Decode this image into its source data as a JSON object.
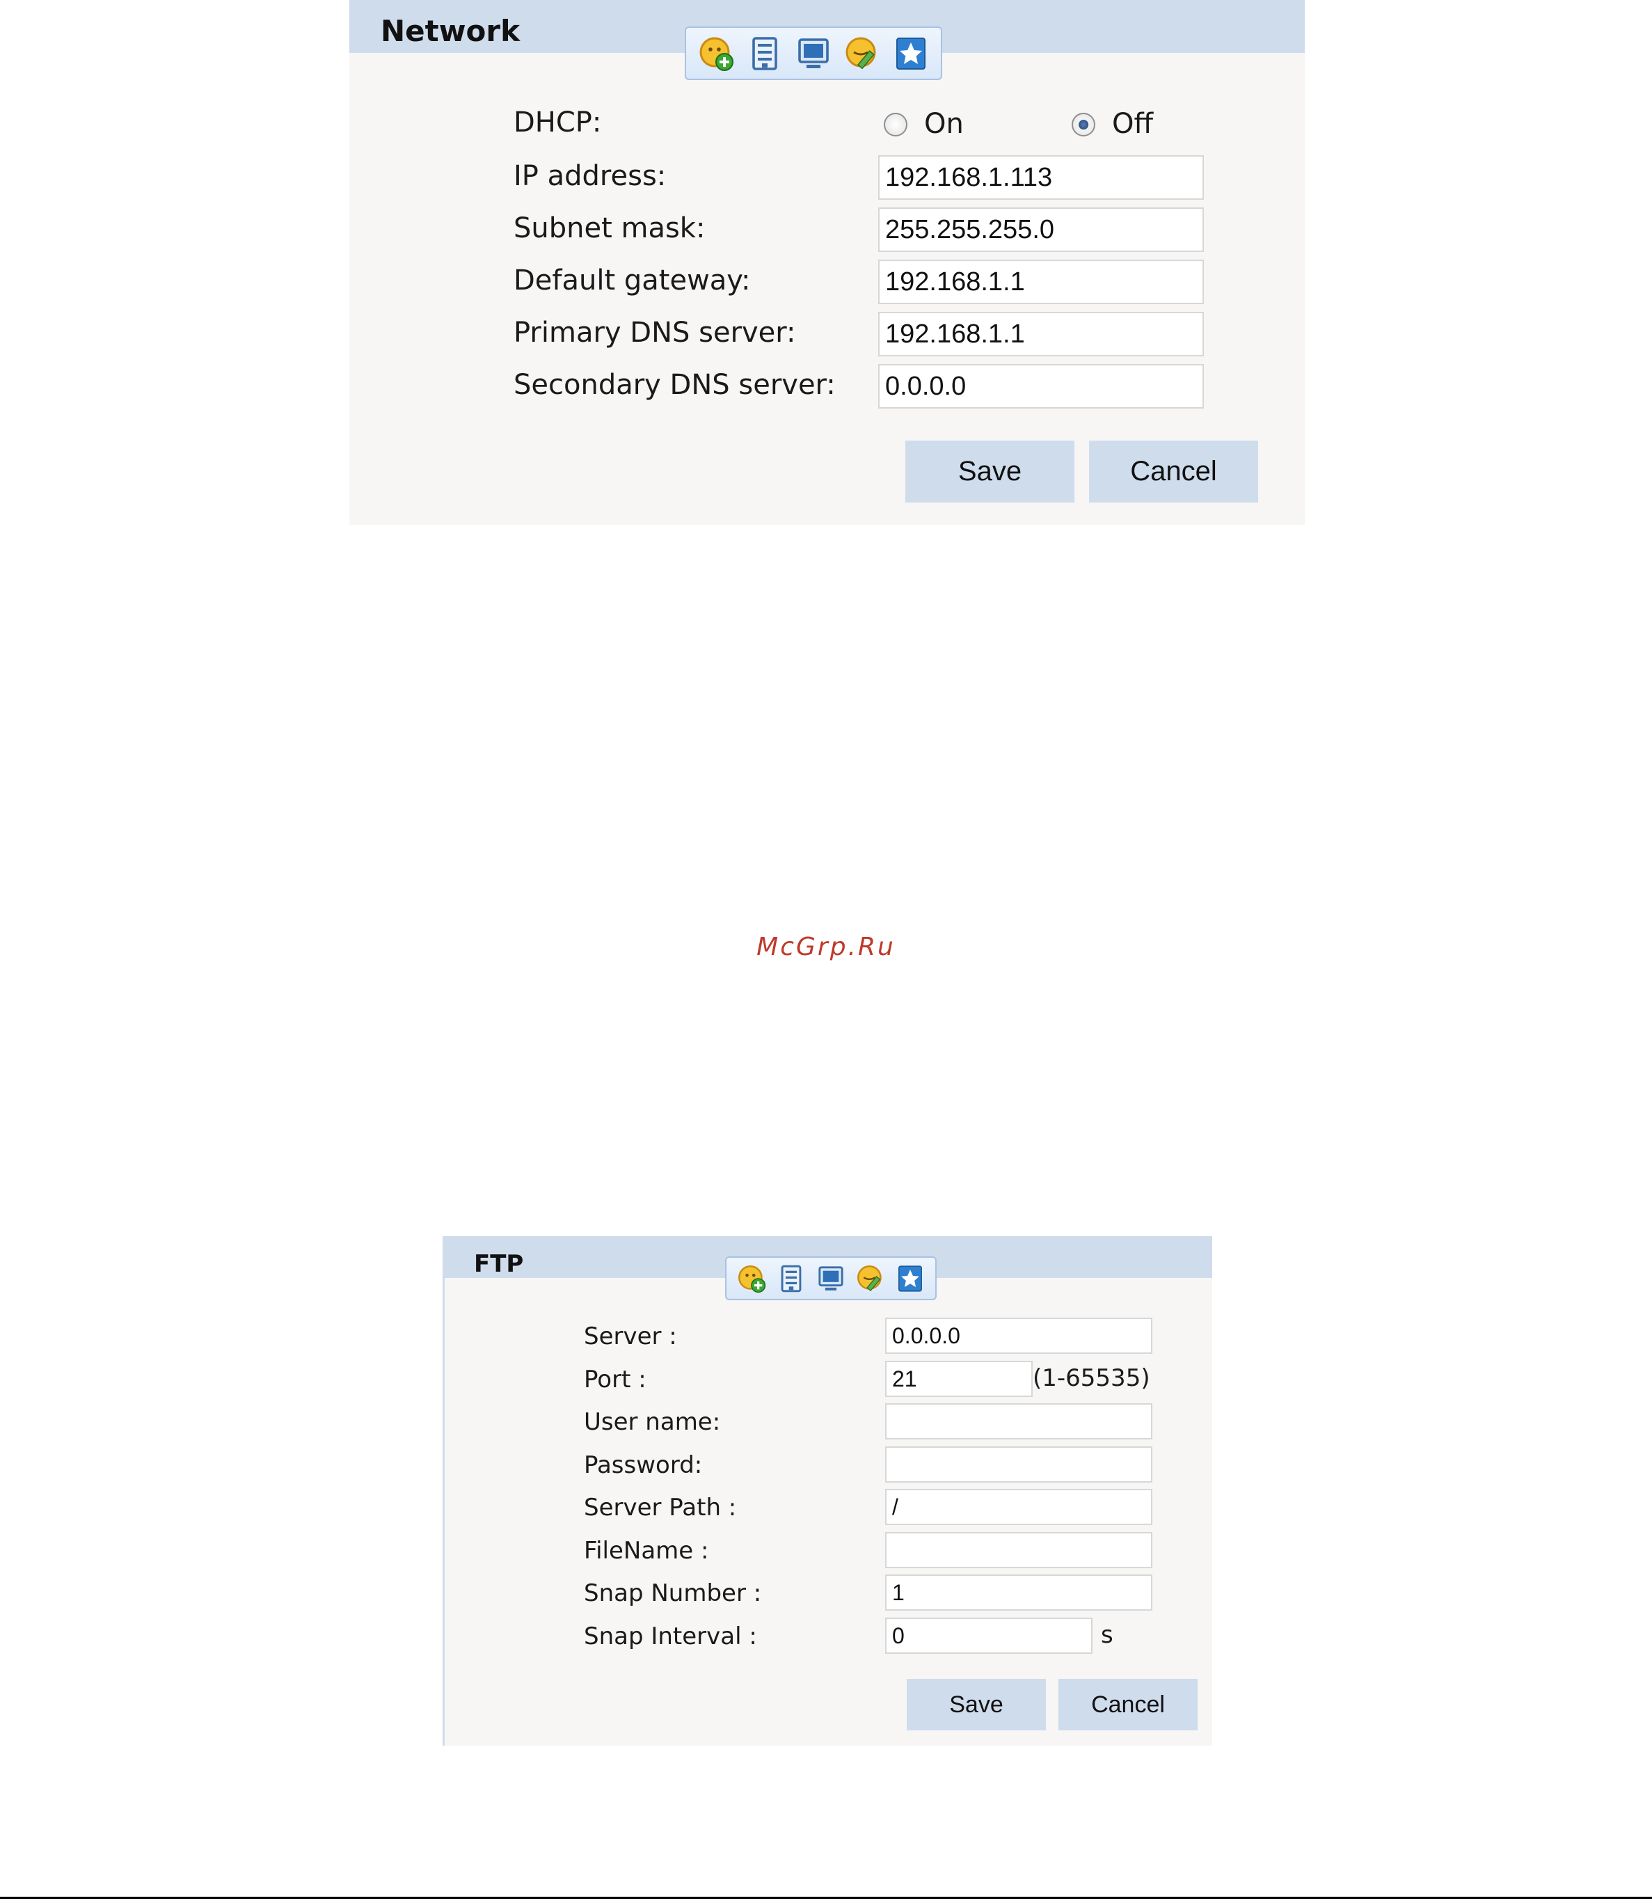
{
  "network": {
    "title": "Network",
    "toolbar_icons": [
      "add-icon",
      "save-icon",
      "monitor-icon",
      "edit-icon",
      "favorite-icon"
    ],
    "dhcp": {
      "label": "DHCP:",
      "on_label": "On",
      "off_label": "Off",
      "selected": "Off"
    },
    "fields": [
      {
        "label": "IP address:",
        "value": "192.168.1.113"
      },
      {
        "label": "Subnet mask:",
        "value": "255.255.255.0"
      },
      {
        "label": "Default gateway:",
        "value": "192.168.1.1"
      },
      {
        "label": "Primary DNS server:",
        "value": "192.168.1.1"
      },
      {
        "label": "Secondary DNS server:",
        "value": "0.0.0.0"
      }
    ],
    "save_label": "Save",
    "cancel_label": "Cancel"
  },
  "watermark": "McGrp.Ru",
  "ftp": {
    "title": "FTP",
    "toolbar_icons": [
      "add-icon",
      "save-icon",
      "monitor-icon",
      "edit-icon",
      "favorite-icon"
    ],
    "fields": [
      {
        "label": "Server :",
        "value": "0.0.0.0"
      },
      {
        "label": "Port :",
        "value": "21",
        "suffix": "(1-65535)"
      },
      {
        "label": "User name:",
        "value": ""
      },
      {
        "label": "Password:",
        "value": ""
      },
      {
        "label": "Server Path :",
        "value": "/"
      },
      {
        "label": "FileName :",
        "value": ""
      },
      {
        "label": "Snap Number :",
        "value": "1"
      },
      {
        "label": "Snap Interval :",
        "value": "0",
        "suffix": "s"
      }
    ],
    "save_label": "Save",
    "cancel_label": "Cancel"
  },
  "colors": {
    "header_bg": "#cfdcec",
    "panel_bg": "#f7f6f5",
    "button_bg": "#cfdcec",
    "watermark": "#c0392b"
  }
}
